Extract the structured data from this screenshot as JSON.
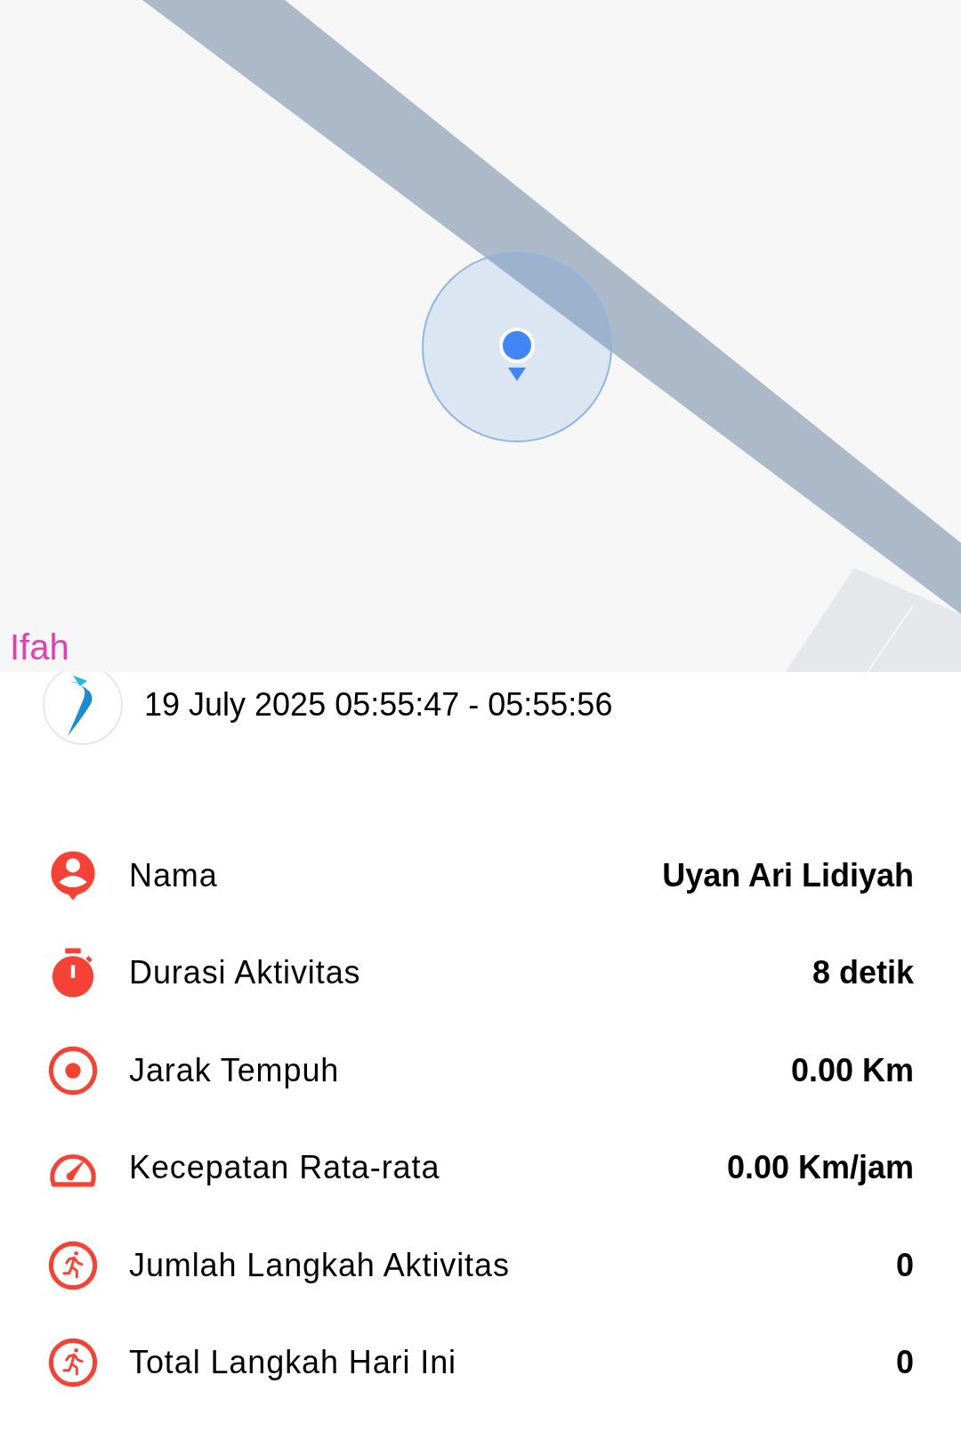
{
  "map": {
    "label": "Ifah"
  },
  "session": {
    "time_range": "19 July 2025 05:55:47 - 05:55:56"
  },
  "stats": [
    {
      "kind": "person",
      "label": "Nama",
      "value": "Uyan Ari Lidiyah"
    },
    {
      "kind": "stopwatch",
      "label": "Durasi Aktivitas",
      "value": "8 detik"
    },
    {
      "kind": "target",
      "label": "Jarak Tempuh",
      "value": "0.00 Km"
    },
    {
      "kind": "speed",
      "label": "Kecepatan Rata-rata",
      "value": "0.00 Km/jam"
    },
    {
      "kind": "runner",
      "label": "Jumlah Langkah Aktivitas",
      "value": "0"
    },
    {
      "kind": "runner",
      "label": "Total Langkah Hari Ini",
      "value": "0"
    }
  ]
}
